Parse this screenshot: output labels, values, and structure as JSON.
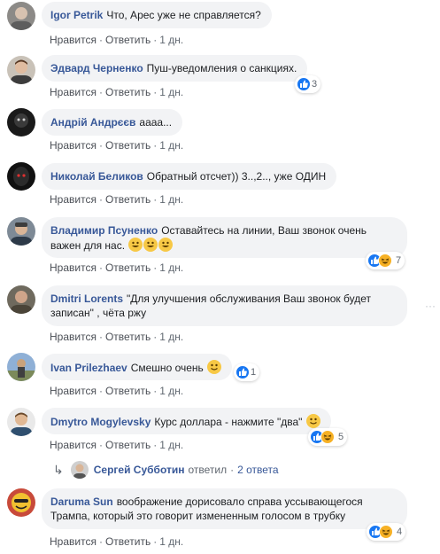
{
  "comments": [
    {
      "author": "Igor Petrik",
      "text": "Что, Арес уже не справляется?",
      "like_label": "Нравится",
      "reply_label": "Ответить",
      "time": "1 дн."
    },
    {
      "author": "Эдвард Черненко",
      "text": "Пуш-уведомления о санкциях.",
      "like_label": "Нравится",
      "reply_label": "Ответить",
      "time": "1 дн.",
      "reactions": "3"
    },
    {
      "author": "Андрій Андрєєв",
      "text": "аааа...",
      "like_label": "Нравится",
      "reply_label": "Ответить",
      "time": "1 дн."
    },
    {
      "author": "Николай Беликов",
      "text": "Обратный отсчет)) 3..,2.., уже ОДИН",
      "like_label": "Нравится",
      "reply_label": "Ответить",
      "time": "1 дн."
    },
    {
      "author": "Владимир Псуненко",
      "text_line1": "Оставайтесь на линии, Ваш звонок очень",
      "text_line2": "важен для нас.",
      "like_label": "Нравится",
      "reply_label": "Ответить",
      "time": "1 дн.",
      "reactions": "7"
    },
    {
      "author": "Dmitri Lorents",
      "text_line1": "\"Для улучшения обслуживания Ваш звонок будет",
      "text_line2": "записан\" , чёта ржу",
      "like_label": "Нравится",
      "reply_label": "Ответить",
      "time": "1 дн."
    },
    {
      "author": "Ivan Prilezhaev",
      "text": "Смешно очень",
      "like_label": "Нравится",
      "reply_label": "Ответить",
      "time": "1 дн.",
      "reactions": "1"
    },
    {
      "author": "Dmytro Mogylevsky",
      "text": "Курс доллара - нажмите \"два\"",
      "like_label": "Нравится",
      "reply_label": "Ответить",
      "time": "1 дн.",
      "reactions": "5"
    },
    {
      "author": "Daruma Sun",
      "text_line1": "воображение дорисовало справа уссывающегося",
      "text_line2": "Трампа, который это говорит измененным голосом в трубку",
      "like_label": "Нравится",
      "reply_label": "Ответить",
      "time": "1 дн.",
      "reactions": "4"
    }
  ],
  "replies_summary": {
    "name": "Сергей Субботин",
    "verb": "ответил",
    "count": "2 ответа"
  },
  "separator": "·",
  "colors": {
    "author": "#385898",
    "bubble": "#f2f3f5",
    "like": "#1877f2",
    "haha": "#f7b125"
  }
}
